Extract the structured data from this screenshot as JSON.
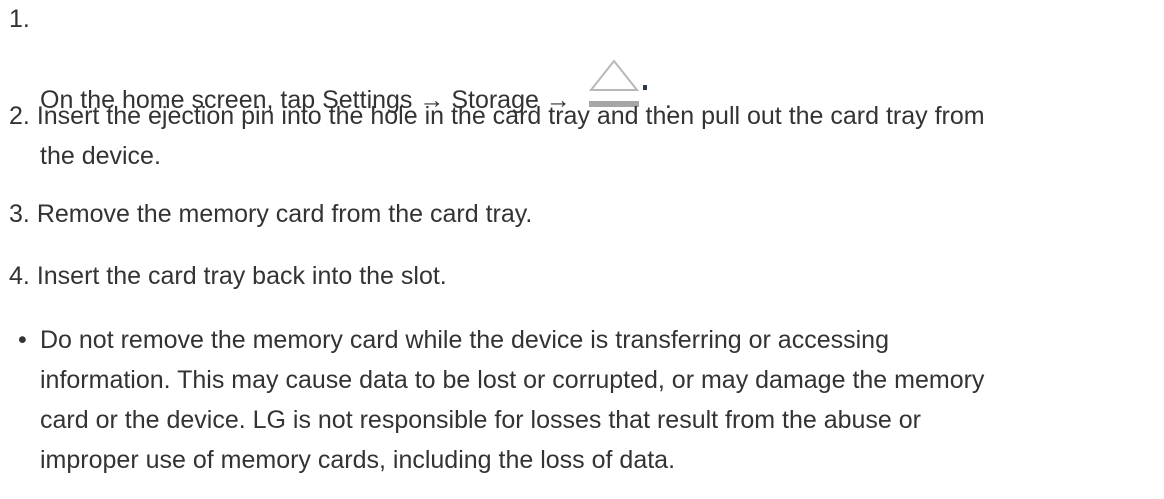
{
  "steps": {
    "step1": {
      "number": "1.",
      "text_before": "On the home screen, tap Settings → Storage →",
      "icon": "eject-icon",
      "text_after": "."
    },
    "step2": {
      "number": "2.",
      "text_line1": "Insert the ejection pin into the hole in the card tray and then pull out the card tray from",
      "text_line2": "the device."
    },
    "step3": {
      "number": "3.",
      "text": "Remove the memory card from the card tray."
    },
    "step4": {
      "number": "4.",
      "text": "Insert the card tray back into the slot."
    }
  },
  "note": {
    "bullet": "•",
    "lines": [
      "Do not remove the memory card while the device is transferring or accessing",
      "information. This may cause data to be lost or corrupted, or may damage the memory",
      "card or the device. LG is not responsible for losses that result from the abuse or",
      "improper use of memory cards, including the loss of data."
    ]
  },
  "colors": {
    "text": "#333333",
    "icon_outline": "#b8b8b8",
    "icon_bar": "#a6a6a6",
    "icon_dot": "#2a3a4a"
  }
}
